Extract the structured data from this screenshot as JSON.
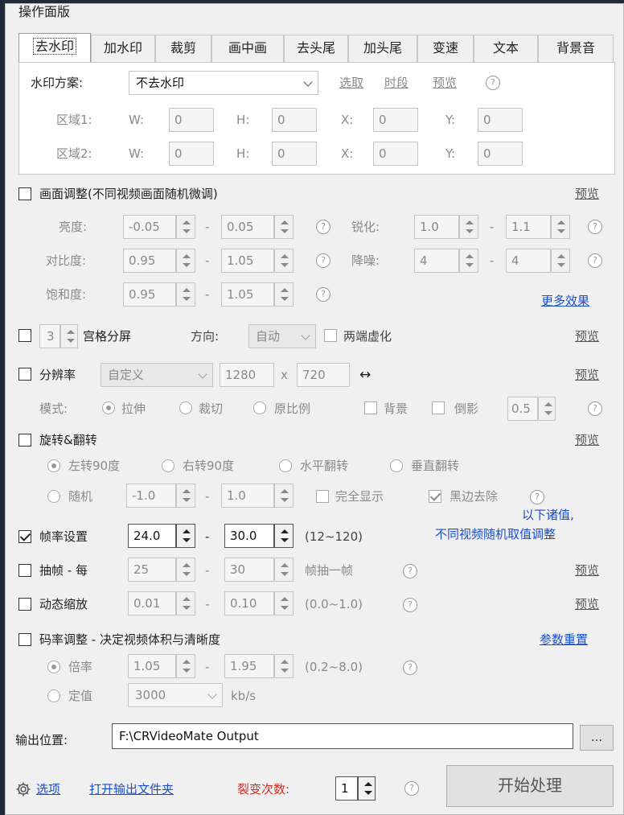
{
  "panel_title": "操作面版",
  "tabs": [
    "去水印",
    "加水印",
    "裁剪",
    "画中画",
    "去头尾",
    "加头尾",
    "变速",
    "文本",
    "背景音"
  ],
  "watermark": {
    "scheme_label": "水印方案:",
    "scheme_value": "不去水印",
    "select_link": "选取",
    "time_link": "时段",
    "preview_link": "预览",
    "help": "?",
    "regions": [
      {
        "label": "区域1:",
        "w_label": "W:",
        "w": "0",
        "h_label": "H:",
        "h": "0",
        "x_label": "X:",
        "x": "0",
        "y_label": "Y:",
        "y": "0"
      },
      {
        "label": "区域2:",
        "w_label": "W:",
        "w": "0",
        "h_label": "H:",
        "h": "0",
        "x_label": "X:",
        "x": "0",
        "y_label": "Y:",
        "y": "0"
      }
    ]
  },
  "image_adjust": {
    "title": "画面调整(不同视频画面随机微调)",
    "preview": "预览",
    "brightness_label": "亮度:",
    "brightness_min": "-0.05",
    "brightness_max": "0.05",
    "sharpen_label": "锐化:",
    "sharpen_min": "1.0",
    "sharpen_max": "1.1",
    "contrast_label": "对比度:",
    "contrast_min": "0.95",
    "contrast_max": "1.05",
    "denoise_label": "降噪:",
    "denoise_min": "4",
    "denoise_max": "4",
    "saturation_label": "饱和度:",
    "saturation_min": "0.95",
    "saturation_max": "1.05",
    "more_effects": "更多效果",
    "dash": "-"
  },
  "grid": {
    "count": "3",
    "label": "宫格分屏",
    "direction_label": "方向:",
    "direction_value": "自动",
    "blur_label": "两端虚化",
    "preview": "预览"
  },
  "resolution": {
    "label": "分辨率",
    "preset": "自定义",
    "width": "1280",
    "x": "x",
    "height": "720",
    "swap": "↔",
    "preview": "预览",
    "mode_label": "模式:",
    "stretch": "拉伸",
    "crop": "裁切",
    "original": "原比例",
    "background": "背景",
    "reflection": "倒影",
    "reflection_value": "0.5"
  },
  "rotate": {
    "label": "旋转&翻转",
    "preview": "预览",
    "left90": "左转90度",
    "right90": "右转90度",
    "hflip": "水平翻转",
    "vflip": "垂直翻转",
    "random": "随机",
    "random_min": "-1.0",
    "random_max": "1.0",
    "full_display": "完全显示",
    "remove_black": "黑边去除"
  },
  "notice": {
    "line1": "以下诸值,",
    "line2": "不同视频随机取值调整"
  },
  "framerate": {
    "label": "帧率设置",
    "min": "24.0",
    "max": "30.0",
    "range": "(12~120)"
  },
  "frame_drop": {
    "label": "抽帧 - 每",
    "min": "25",
    "max": "30",
    "suffix": "帧抽一帧",
    "preview": "预览"
  },
  "zoom": {
    "label": "动态缩放",
    "min": "0.01",
    "max": "0.10",
    "range": "(0.0~1.0)",
    "preview": "预览"
  },
  "bitrate": {
    "label": "码率调整 - 决定视频体积与清晰度",
    "reset": "参数重置",
    "multiplier_label": "倍率",
    "mult_min": "1.05",
    "mult_max": "1.95",
    "mult_range": "(0.2~8.0)",
    "fixed_label": "定值",
    "fixed_value": "3000",
    "unit": "kb/s"
  },
  "output": {
    "label": "输出位置:",
    "path": "F:\\CRVideoMate Output",
    "browse": "..."
  },
  "footer": {
    "options": "选项",
    "open_folder": "打开输出文件夹",
    "fission_label": "裂变次数:",
    "fission_value": "1",
    "start": "开始处理"
  }
}
